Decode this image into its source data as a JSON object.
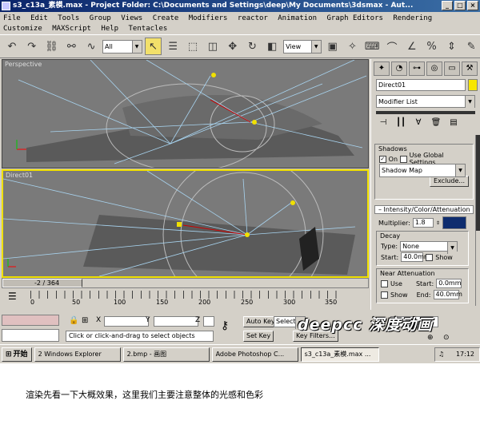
{
  "window": {
    "title": "s3_c13a_素模.max - Project Folder: C:\\Documents and Settings\\deep\\My Documents\\3dsmax - Aut..."
  },
  "menu": [
    "File",
    "Edit",
    "Tools",
    "Group",
    "Views",
    "Create",
    "Modifiers",
    "reactor",
    "Animation",
    "Graph Editors",
    "Rendering",
    "Customize",
    "MAXScript",
    "Help",
    "Tentacles"
  ],
  "toolbar": {
    "selection_filter": "All",
    "coord_system": "View"
  },
  "viewports": {
    "top_label": "Perspective",
    "bottom_label": "Direct01"
  },
  "command_panel": {
    "object_name": "Direct01",
    "modifier_list": "Modifier List",
    "shadows": {
      "title": "Shadows",
      "on_label": "On",
      "on_checked": true,
      "global_label": "Use Global Settings",
      "type": "Shadow Map",
      "exclude_label": "Exclude..."
    },
    "intensity": {
      "title": "Intensity/Color/Attenuation",
      "multiplier_label": "Multiplier:",
      "multiplier": "1.8",
      "color": "#0e2c6e"
    },
    "decay": {
      "title": "Decay",
      "type_label": "Type:",
      "type": "None",
      "start_label": "Start:",
      "start": "40.0mm",
      "show_label": "Show"
    },
    "near": {
      "title": "Near Attenuation",
      "use_label": "Use",
      "start_label": "Start:",
      "start": "0.0mm",
      "show_label": "Show",
      "end_label": "End:",
      "end": "40.0mm"
    }
  },
  "timeline": {
    "slider": "-2 / 364",
    "ticks": [
      "0",
      "50",
      "100",
      "150",
      "200",
      "250",
      "300",
      "350"
    ]
  },
  "status": {
    "x_label": "X",
    "y_label": "Y",
    "z_label": "Z",
    "prompt": "Click or click-and-drag to select objects",
    "autokey": "Auto Key",
    "setkey": "Set Key",
    "selected": "Selecte",
    "keyfilters": "Key Filters...",
    "frame": "-2"
  },
  "watermark": "deepcc 深度动画",
  "taskbar": {
    "start": "开始",
    "tasks": [
      "2 Windows Explorer",
      "2.bmp - 画图",
      "Adobe Photoshop C...",
      "s3_c13a_素模.max ..."
    ],
    "clock": "17:12"
  },
  "caption": "渲染先看一下大概效果，这里我们主要注意整体的光感和色彩"
}
